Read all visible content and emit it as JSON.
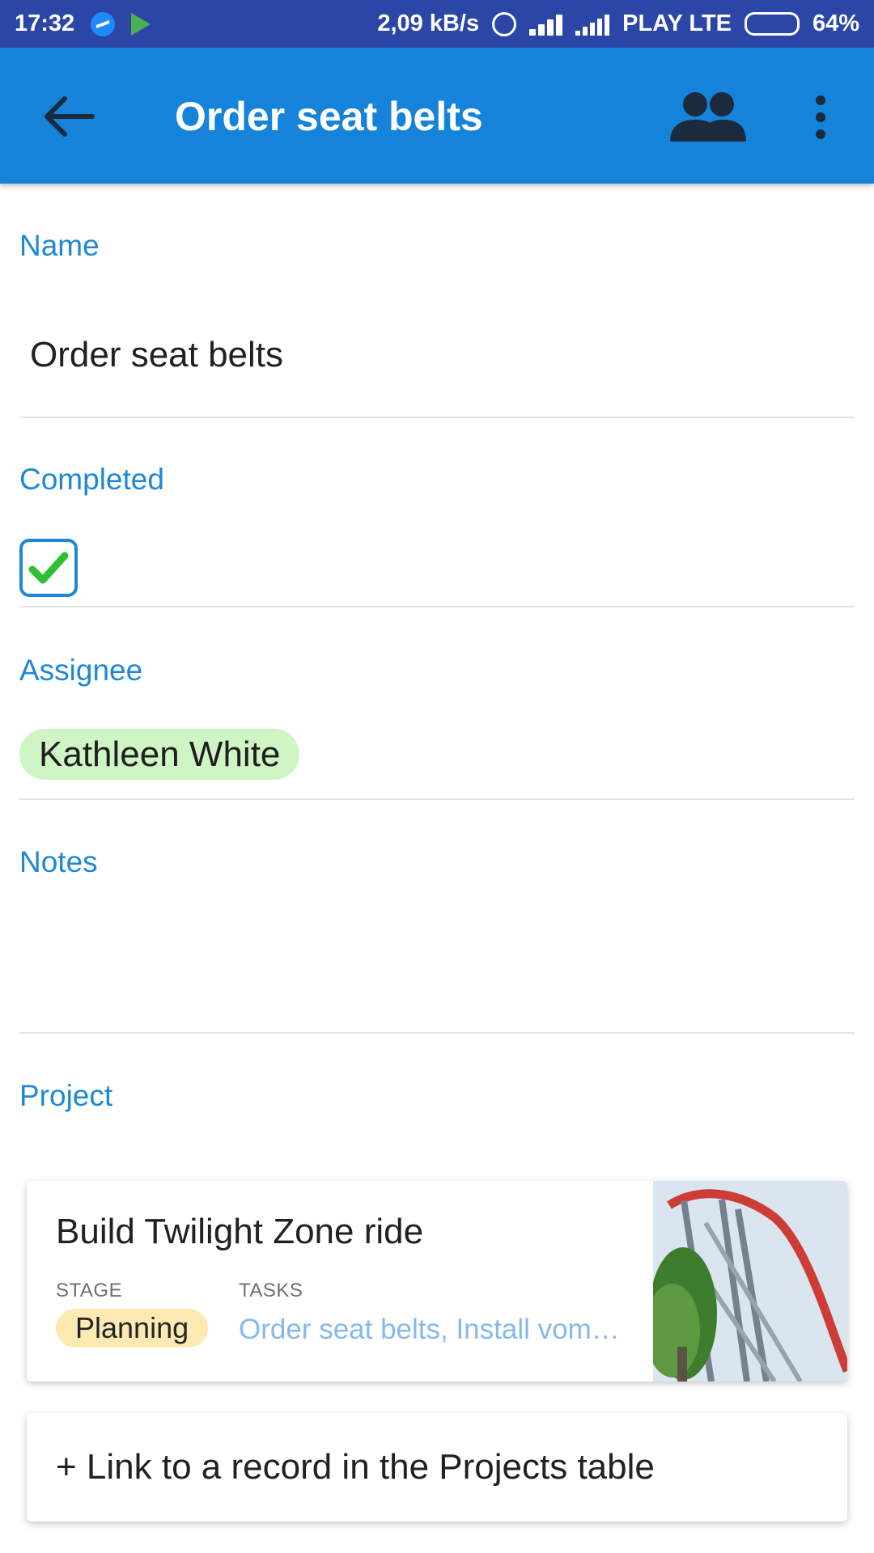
{
  "status_bar": {
    "time": "17:32",
    "network_speed": "2,09 kB/s",
    "carrier": "PLAY LTE",
    "battery": "64%",
    "battery_level": 0.64,
    "icons": [
      "messenger-icon",
      "play-store-icon",
      "alarm-icon",
      "wifi-icon",
      "signal-icon",
      "battery-icon"
    ]
  },
  "app_bar": {
    "title": "Order seat belts",
    "back_icon": "arrow-left-icon",
    "collaborators_icon": "people-icon",
    "more_icon": "more-vertical-icon",
    "background": "#1483d9"
  },
  "fields": {
    "name": {
      "label": "Name",
      "value": "Order seat belts"
    },
    "completed": {
      "label": "Completed",
      "checked": true
    },
    "assignee": {
      "label": "Assignee",
      "value": "Kathleen White"
    },
    "notes": {
      "label": "Notes",
      "value": ""
    },
    "project": {
      "label": "Project"
    }
  },
  "project_card": {
    "name": "Build Twilight Zone ride",
    "stage_label": "STAGE",
    "stage_value": "Planning",
    "tasks_label": "TASKS",
    "tasks_value": "Order seat belts, Install vom…"
  },
  "link_button": {
    "label": "+ Link to a record in the Projects table"
  },
  "colors": {
    "label_blue": "#1e88d6",
    "status_bar": "#2b46a6",
    "assignee_chip": "#cff5c5",
    "stage_chip": "#fdeab3",
    "check_green": "#2fbf35",
    "tasks_text": "#86b9eb"
  }
}
